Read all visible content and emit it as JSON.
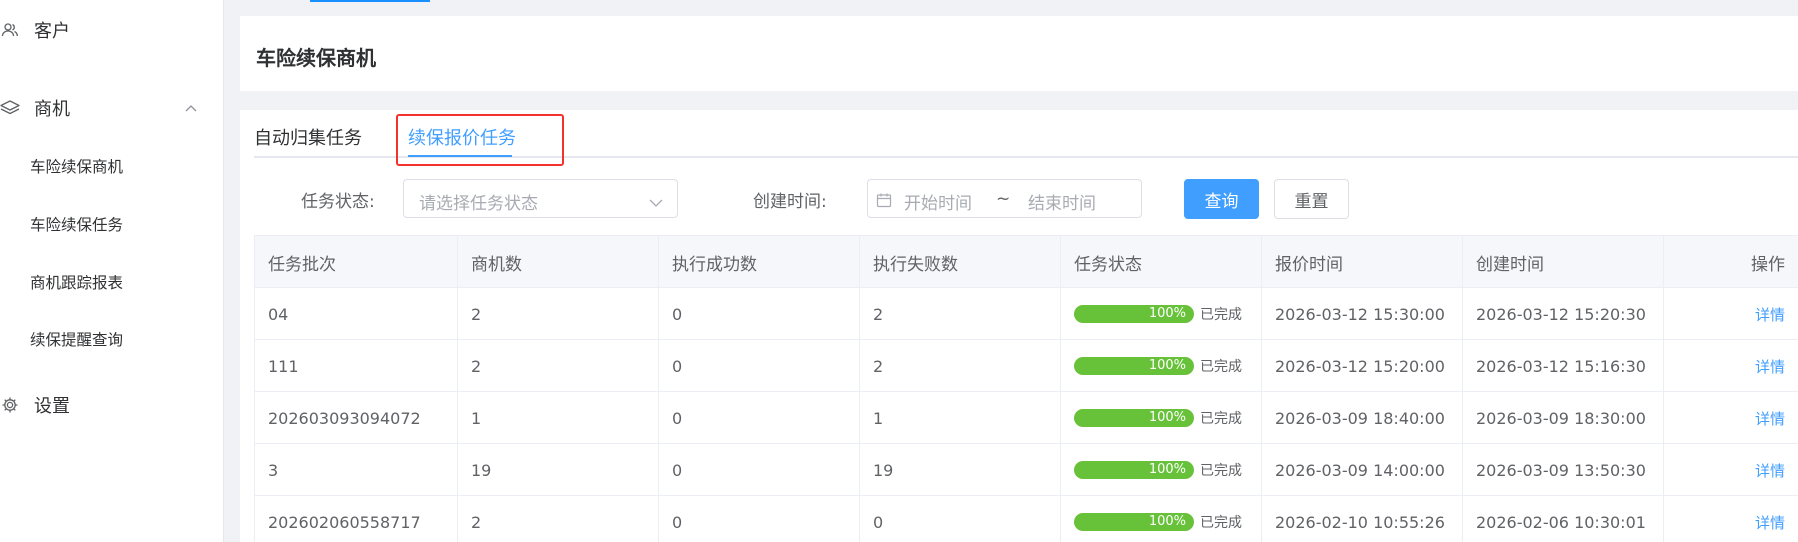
{
  "sidebar": {
    "groups": [
      {
        "label": "客户",
        "icon": "users-icon"
      },
      {
        "label": "商机",
        "icon": "layers-icon",
        "expanded": true
      },
      {
        "label": "设置",
        "icon": "gear-icon"
      }
    ],
    "sub_items": [
      {
        "label": "车险续保商机"
      },
      {
        "label": "车险续保任务"
      },
      {
        "label": "商机跟踪报表"
      },
      {
        "label": "续保提醒查询"
      }
    ]
  },
  "header": {
    "title": "车险续保商机"
  },
  "tabs": [
    {
      "label": "自动归集任务",
      "active": false
    },
    {
      "label": "续保报价任务",
      "active": true
    }
  ],
  "filters": {
    "status_label": "任务状态:",
    "status_placeholder": "请选择任务状态",
    "created_label": "创建时间:",
    "start_placeholder": "开始时间",
    "range_separator": "~",
    "end_placeholder": "结束时间",
    "query_button": "查询",
    "reset_button": "重置"
  },
  "table": {
    "columns": [
      "任务批次",
      "商机数",
      "执行成功数",
      "执行失败数",
      "任务状态",
      "报价时间",
      "创建时间",
      "操作"
    ],
    "rows": [
      {
        "batch": "04",
        "count": "2",
        "success": "0",
        "fail": "2",
        "progress": "100%",
        "status": "已完成",
        "quote_time": "2026-03-12 15:30:00",
        "created": "2026-03-12 15:20:30",
        "action": "详情"
      },
      {
        "batch": "111",
        "count": "2",
        "success": "0",
        "fail": "2",
        "progress": "100%",
        "status": "已完成",
        "quote_time": "2026-03-12 15:20:00",
        "created": "2026-03-12 15:16:30",
        "action": "详情"
      },
      {
        "batch": "202603093094072",
        "count": "1",
        "success": "0",
        "fail": "1",
        "progress": "100%",
        "status": "已完成",
        "quote_time": "2026-03-09 18:40:00",
        "created": "2026-03-09 18:30:00",
        "action": "详情"
      },
      {
        "batch": "3",
        "count": "19",
        "success": "0",
        "fail": "19",
        "progress": "100%",
        "status": "已完成",
        "quote_time": "2026-03-09 14:00:00",
        "created": "2026-03-09 13:50:30",
        "action": "详情"
      },
      {
        "batch": "202602060558717",
        "count": "2",
        "success": "0",
        "fail": "0",
        "progress": "100%",
        "status": "已完成",
        "quote_time": "2026-02-10 10:55:26",
        "created": "2026-02-06 10:30:01",
        "action": "详情"
      }
    ]
  },
  "colors": {
    "primary": "#409eff",
    "progress": "#67c23a",
    "highlight": "#f5312d"
  }
}
